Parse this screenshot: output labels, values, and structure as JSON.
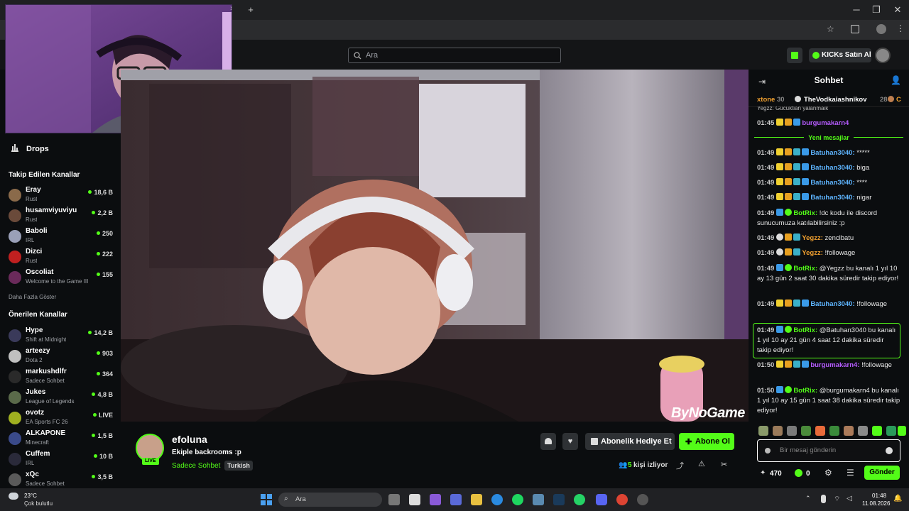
{
  "browser": {
    "new_tab": "+",
    "close_tab": "×",
    "win_min": "─",
    "win_max": "❐",
    "win_close": "✕"
  },
  "header": {
    "search_placeholder": "Ara",
    "kicks_label": "KICKs Satın Al"
  },
  "sidebar": {
    "drops_label": "Drops",
    "followed_heading": "Takip Edilen Kanallar",
    "followed": [
      {
        "name": "Eray",
        "game": "Rust",
        "viewers": "18,6 B",
        "color": "#8a6a4a"
      },
      {
        "name": "husamviyuviyu",
        "game": "Rust",
        "viewers": "2,2 B",
        "color": "#6a4a3a"
      },
      {
        "name": "Baboli",
        "game": "IRL",
        "viewers": "250",
        "color": "#9aa0b8"
      },
      {
        "name": "Dizci",
        "game": "Rust",
        "viewers": "222",
        "color": "#c02020"
      },
      {
        "name": "Oscoliat",
        "game": "Welcome to the Game III",
        "viewers": "155",
        "color": "#6a2a5a"
      }
    ],
    "show_more": "Daha Fazla Göster",
    "recommended_heading": "Önerilen Kanallar",
    "recommended": [
      {
        "name": "Hype",
        "game": "Shift at Midnight",
        "viewers": "14,2 B",
        "color": "#3a3a5a"
      },
      {
        "name": "arteezy",
        "game": "Dota 2",
        "viewers": "903",
        "color": "#c0c0c0"
      },
      {
        "name": "markushdlfr",
        "game": "Sadece Sohbet",
        "viewers": "364",
        "color": "#2a2a2a"
      },
      {
        "name": "Jukes",
        "game": "League of Legends",
        "viewers": "4,8 B",
        "color": "#5a6a4a"
      },
      {
        "name": "ovotz",
        "game": "EA Sports FC 26",
        "viewers": "LIVE",
        "color": "#a0b020"
      },
      {
        "name": "ALKAPONE",
        "game": "Minecraft",
        "viewers": "1,5 B",
        "color": "#3a4a8a"
      },
      {
        "name": "Cuffem",
        "game": "IRL",
        "viewers": "10 B",
        "color": "#2a2a3a"
      },
      {
        "name": "xQc",
        "game": "Sadece Sohbet",
        "viewers": "3,5 B",
        "color": "#5a5a5a"
      }
    ]
  },
  "video": {
    "watermark": "ByNoGame"
  },
  "stream": {
    "channel_name": "efoluna",
    "live_badge": "LIVE",
    "title": "Ekiple backrooms :p",
    "category": "Sadece Sohbet",
    "language_tag": "Turkish",
    "gift_sub_label": "Abonelik Hediye Et",
    "subscribe_label": "Abone Ol",
    "viewer_count": "5",
    "viewer_suffix": "kişi izliyor"
  },
  "chat": {
    "title": "Sohbet",
    "top_gifters": [
      {
        "name": "xtone",
        "count": "30"
      },
      {
        "name": "TheVodkaiashnikov",
        "count": "28"
      },
      {
        "name": "C",
        "count": "3"
      }
    ],
    "partial_msg": "Yegzz: Gucuktian yalanmaik",
    "msg_0145": {
      "ts": "01:45",
      "user": "burgumakarn4",
      "text": ""
    },
    "new_messages": "Yeni mesajlar",
    "messages": [
      {
        "ts": "01:49",
        "user": "Batuhan3040",
        "text": "*****",
        "color": "#5eb5ff"
      },
      {
        "ts": "01:49",
        "user": "Batuhan3040",
        "text": "biga",
        "color": "#5eb5ff"
      },
      {
        "ts": "01:49",
        "user": "Batuhan3040",
        "text": "****",
        "color": "#5eb5ff"
      },
      {
        "ts": "01:49",
        "user": "Batuhan3040",
        "text": "nigar",
        "color": "#5eb5ff"
      },
      {
        "ts": "01:49",
        "user": "BotRix",
        "text": "!dc kodu ile discord sunucumuza katılabilirsiniz :p",
        "color": "#53fc18"
      },
      {
        "ts": "01:49",
        "user": "Yegzz",
        "text": "zenclbatu",
        "color": "#f0a030"
      },
      {
        "ts": "01:49",
        "user": "Yegzz",
        "text": "!followage",
        "color": "#f0a030"
      },
      {
        "ts": "01:49",
        "user": "BotRix",
        "text": "@Yegzz bu kanalı 1 yıl 10 ay 13 gün 2 saat 30 dakika süredir takip ediyor!",
        "color": "#53fc18"
      },
      {
        "ts": "01:49",
        "user": "Batuhan3040",
        "text": "!followage",
        "color": "#5eb5ff"
      },
      {
        "ts": "01:49",
        "user": "BotRix",
        "text": "@Batuhan3040 bu kanalı 1 yıl 10 ay 21 gün 4 saat 12 dakika süredir takip ediyor!",
        "color": "#53fc18"
      },
      {
        "ts": "01:50",
        "user": "burgumakarn4",
        "text": "!followage",
        "color": "#b65cff"
      },
      {
        "ts": "01:50",
        "user": "BotRix",
        "text": "@burgumakarn4 bu kanalı 1 yıl 10 ay 15 gün 1 saat 38 dakika süredir takip ediyor!",
        "color": "#53fc18"
      }
    ],
    "input_placeholder": "Bir mesaj gönderin",
    "points": "470",
    "kicks": "0",
    "send_label": "Gönder"
  },
  "taskbar": {
    "weather_temp": "23°C",
    "weather_desc": "Çok bulutlu",
    "search_label": "Ara",
    "time": "01:48",
    "date": "11.08.2026"
  }
}
